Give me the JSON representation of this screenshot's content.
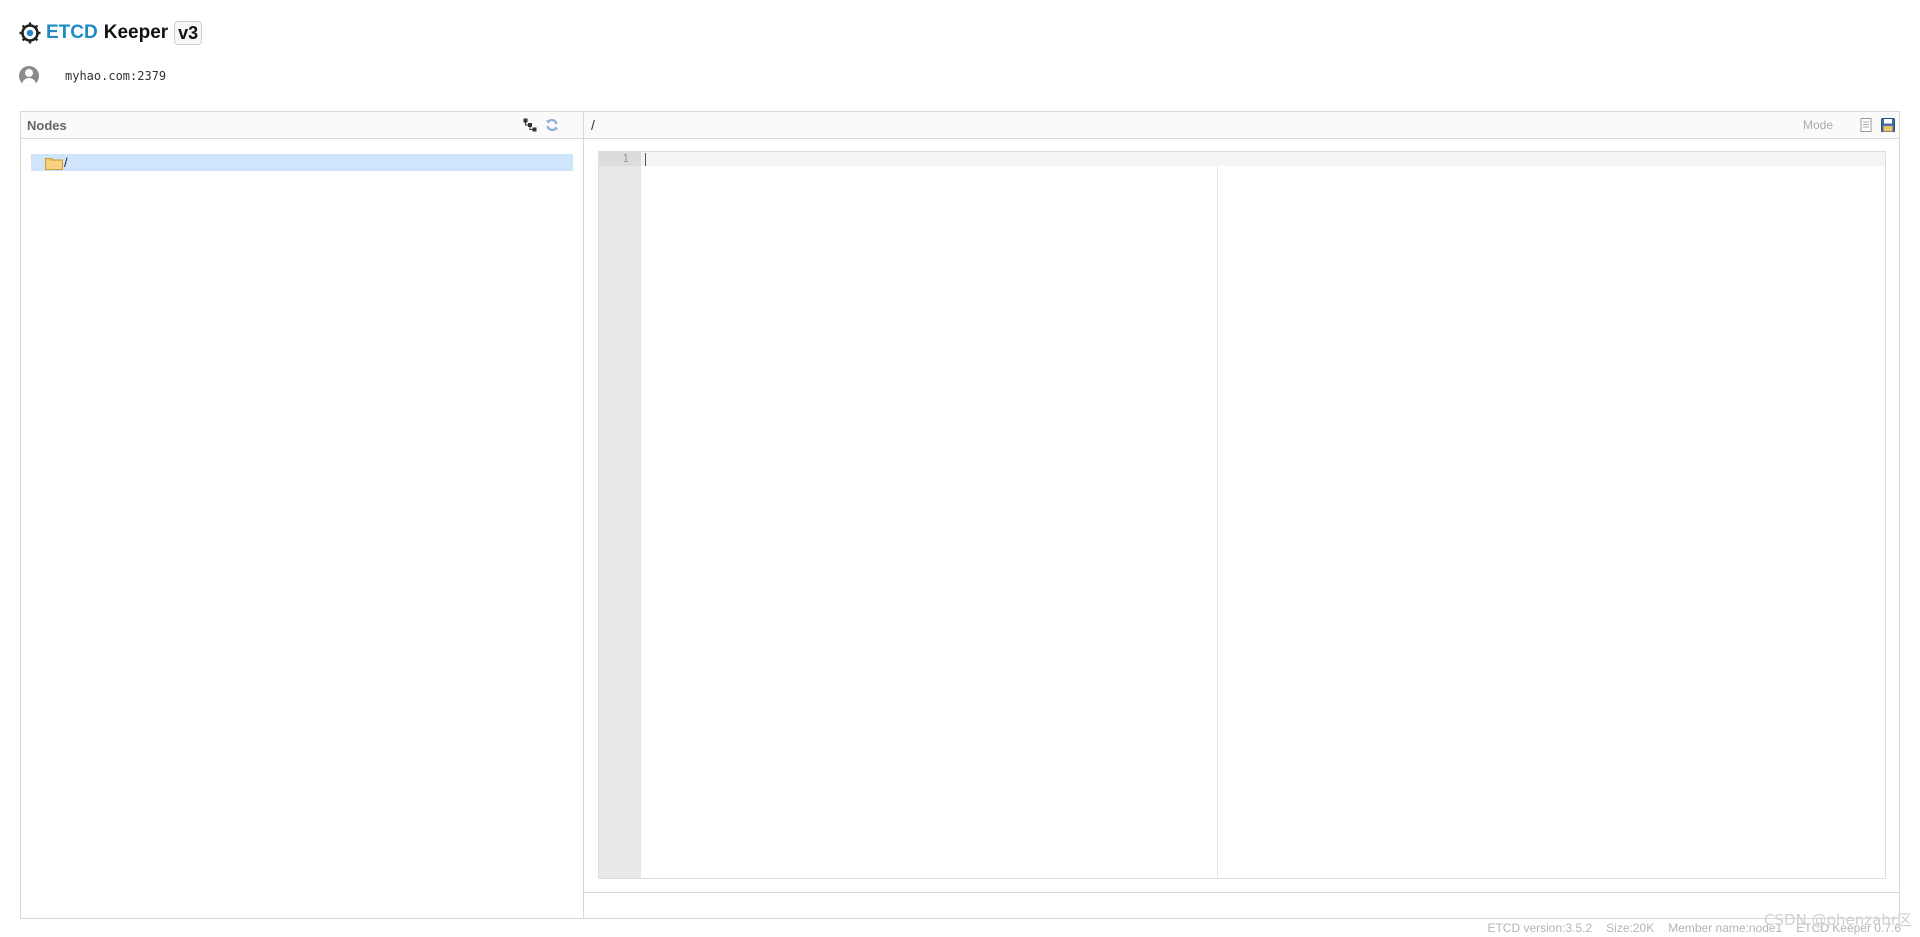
{
  "header": {
    "brand": "ETCD",
    "app_name": "Keeper",
    "version": "v3"
  },
  "host": {
    "address": "myhao.com:2379"
  },
  "nodes_panel": {
    "title": "Nodes",
    "tree": [
      {
        "label": "/",
        "selected": true
      }
    ]
  },
  "editor_panel": {
    "path": "/",
    "mode_label": "Mode",
    "line_numbers": [
      "1"
    ]
  },
  "footer": {
    "etcd_version": "ETCD version:3.5.2",
    "size": "Size:20K",
    "member": "Member name:node1",
    "keeper_version": "ETCD Keeper 0.7.6"
  },
  "watermark": "CSDN @phenzahr区",
  "colors": {
    "brand": "#1e8ac6",
    "selection": "#cfe5fb"
  },
  "icons": [
    "etcd-logo-icon",
    "avatar-icon",
    "tree-view-icon",
    "refresh-icon",
    "folder-icon",
    "document-icon",
    "save-icon"
  ]
}
